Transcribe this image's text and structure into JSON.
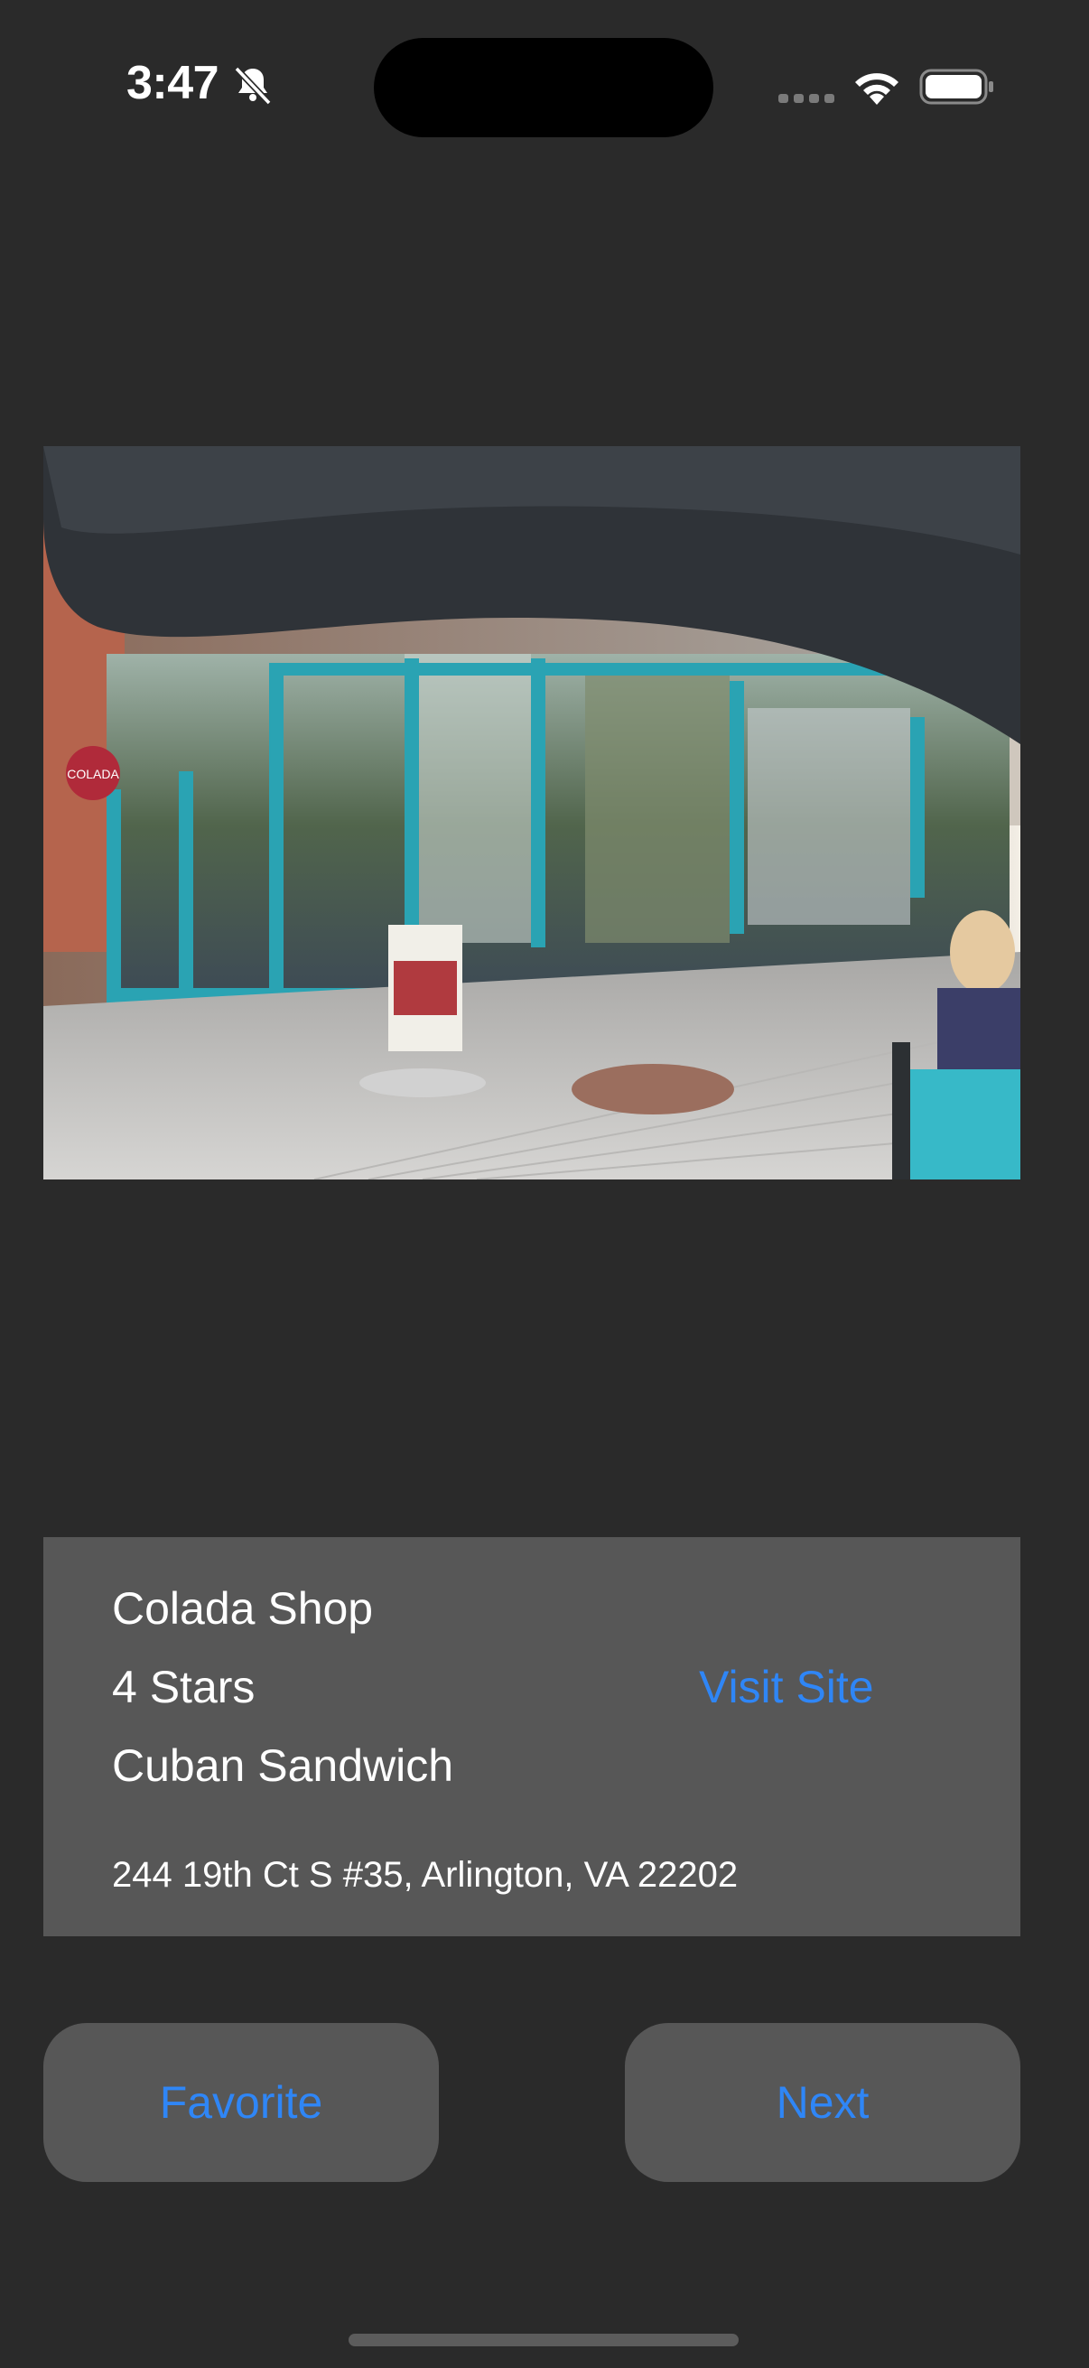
{
  "status_bar": {
    "time": "3:47",
    "icons": [
      "bell-slash-icon",
      "cellular-signal-icon",
      "wifi-icon",
      "battery-icon"
    ]
  },
  "photo": {
    "subject": "restaurant-storefront-photo",
    "sign_text": "COLADA"
  },
  "restaurant": {
    "name": "Colada Shop",
    "rating": "4 Stars",
    "dish": "Cuban Sandwich",
    "address": "244 19th Ct S #35, Arlington, VA 22202",
    "visit_site_label": "Visit Site"
  },
  "actions": {
    "favorite_label": "Favorite",
    "next_label": "Next"
  },
  "colors": {
    "background": "#2a2a2a",
    "card": "#575757",
    "accent": "#2f86f6",
    "text": "#ffffff"
  }
}
